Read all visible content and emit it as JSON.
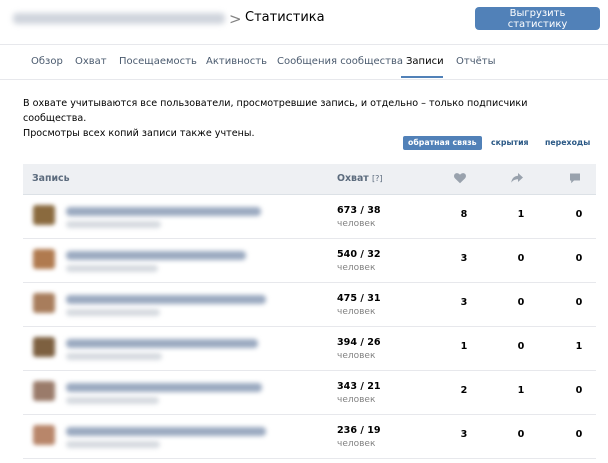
{
  "header": {
    "breadcrumb_blurred": "Онлайн-марафон Ларисы Суриковой",
    "separator": ">",
    "title": "Статистика",
    "export_button": "Выгрузить статистику"
  },
  "tabs": [
    {
      "label": "Обзор",
      "active": false
    },
    {
      "label": "Охват",
      "active": false
    },
    {
      "label": "Посещаемость",
      "active": false
    },
    {
      "label": "Активность",
      "active": false
    },
    {
      "label": "Сообщения сообщества",
      "active": false
    },
    {
      "label": "Записи",
      "active": true
    },
    {
      "label": "Отчёты",
      "active": false
    }
  ],
  "description": {
    "line1": "В охвате учитываются все пользователи, просмотревшие запись, и отдельно – только подписчики сообщества.",
    "line2": "Просмотры всех копий записи также учтены."
  },
  "filters": [
    {
      "label": "обратная связь",
      "active": true
    },
    {
      "label": "скрытия",
      "active": false
    },
    {
      "label": "переходы",
      "active": false
    }
  ],
  "table": {
    "col_post": "Запись",
    "col_reach": "Охват",
    "col_reach_hint": "[?]",
    "icons": [
      "like-icon",
      "share-icon",
      "comment-icon"
    ],
    "rows": [
      {
        "reach": "673 / 38",
        "unit": "человек",
        "likes": "8",
        "shares": "1",
        "comments": "0",
        "thumb_color": "#8a6a3e"
      },
      {
        "reach": "540 / 32",
        "unit": "человек",
        "likes": "3",
        "shares": "0",
        "comments": "0",
        "thumb_color": "#b07a4f"
      },
      {
        "reach": "475 / 31",
        "unit": "человек",
        "likes": "3",
        "shares": "0",
        "comments": "0",
        "thumb_color": "#a87d5c"
      },
      {
        "reach": "394 / 26",
        "unit": "человек",
        "likes": "1",
        "shares": "0",
        "comments": "1",
        "thumb_color": "#7d6040"
      },
      {
        "reach": "343 / 21",
        "unit": "человек",
        "likes": "2",
        "shares": "1",
        "comments": "0",
        "thumb_color": "#9a7b6a"
      },
      {
        "reach": "236 / 19",
        "unit": "человек",
        "likes": "3",
        "shares": "0",
        "comments": "0",
        "thumb_color": "#b8866a"
      }
    ]
  }
}
